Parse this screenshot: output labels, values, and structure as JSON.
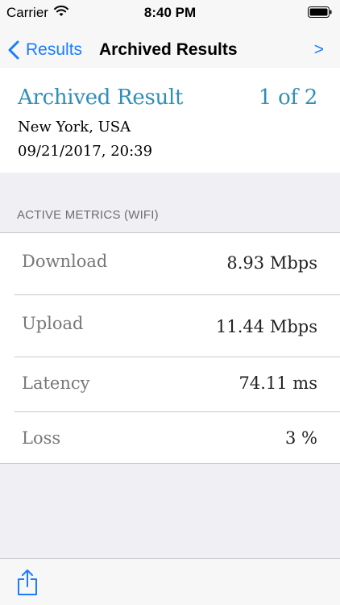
{
  "status_bar": {
    "carrier": "Carrier",
    "time": "8:40 PM",
    "icons": [
      "wifi-icon",
      "battery-icon"
    ]
  },
  "nav": {
    "back_label": "Results",
    "title": "Archived Results",
    "next_label": ">"
  },
  "result": {
    "title": "Archived Result",
    "counter": "1 of 2",
    "location": "New York, USA",
    "datetime": "09/21/2017, 20:39"
  },
  "section": {
    "header": "ACTIVE METRICS (WIFI)"
  },
  "metrics": [
    {
      "label": "Download",
      "value": "8.93 Mbps"
    },
    {
      "label": "Upload",
      "value": "11.44 Mbps"
    },
    {
      "label": "Latency",
      "value": "74.11 ms"
    },
    {
      "label": "Loss",
      "value": "3 %"
    }
  ],
  "toolbar": {
    "icons": [
      "share-icon"
    ]
  },
  "colors": {
    "accent_blue": "#1a7efb",
    "title_teal": "#2f8fb8",
    "group_background": "#efeff4",
    "separator": "#c8c7cc"
  }
}
